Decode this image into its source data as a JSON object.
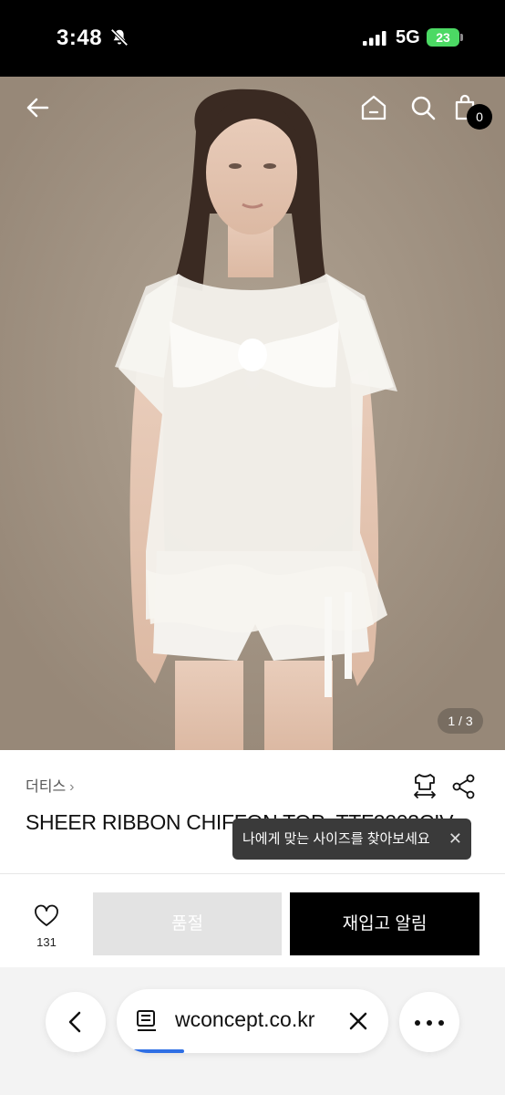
{
  "status_bar": {
    "time": "3:48",
    "network": "5G",
    "battery": "23"
  },
  "hero": {
    "page_indicator": "1 / 3",
    "cart_count": "0"
  },
  "product": {
    "brand": "더티스",
    "brand_chevron": "›",
    "name": "SHEER RIBBON CHIFFON TOP_TTF2203CIV",
    "size_tooltip": "나에게 맞는 사이즈를 찾아보세요",
    "tooltip_close": "✕"
  },
  "actions": {
    "like_count": "131",
    "soldout_label": "품절",
    "restock_label": "재입고 알림"
  },
  "browser": {
    "url": "wconcept.co.kr"
  },
  "colors": {
    "accent": "#000000",
    "soldout": "#e3e3e3",
    "battery": "#4cd964",
    "progress": "#2f6fe4"
  }
}
